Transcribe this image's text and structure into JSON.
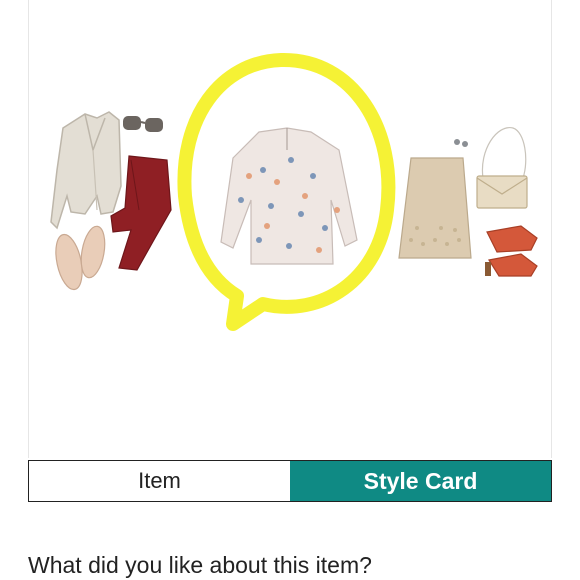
{
  "toggle": {
    "item_label": "Item",
    "style_card_label": "Style Card",
    "active": "Style Card"
  },
  "prompt": {
    "question": "What did you like about this item?"
  },
  "colors": {
    "active_tab": "#0f8a84",
    "highlight": "#f4f12a"
  },
  "outfit_items": [
    "moto-jacket",
    "sunglasses",
    "red-pants",
    "loafers",
    "floral-blouse",
    "eyelet-skirt",
    "earrings",
    "clutch",
    "red-sandals"
  ]
}
